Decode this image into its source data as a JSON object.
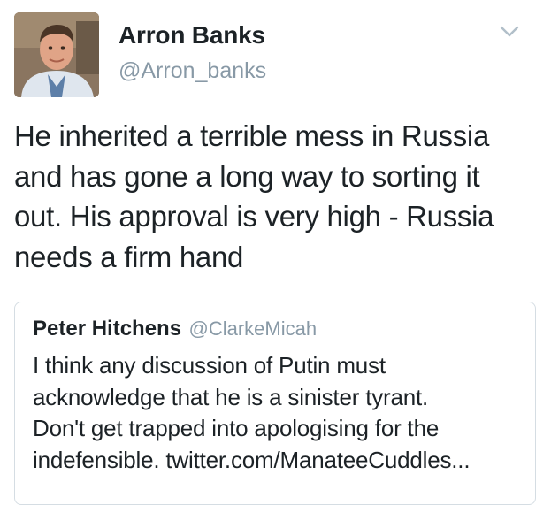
{
  "author": {
    "display_name": "Arron Banks",
    "handle": "@Arron_banks",
    "avatar_icon": "profile-photo"
  },
  "menu_icon": "chevron-down-icon",
  "tweet": {
    "lines": [
      "He inherited a terrible mess in Russia",
      "and has gone a long way to sorting it",
      "out. His approval is very high - Russia",
      "needs a firm hand"
    ]
  },
  "quoted_tweet": {
    "display_name": "Peter Hitchens",
    "handle": "@ClarkeMicah",
    "lines": [
      "I think any discussion of Putin must",
      "acknowledge that he is a sinister tyrant.",
      "Don't get trapped into apologising for the",
      "indefensible. twitter.com/ManateeCuddles..."
    ]
  },
  "colors": {
    "text": "#1c2226",
    "secondary": "#8899a6",
    "border": "#d5dde3"
  }
}
